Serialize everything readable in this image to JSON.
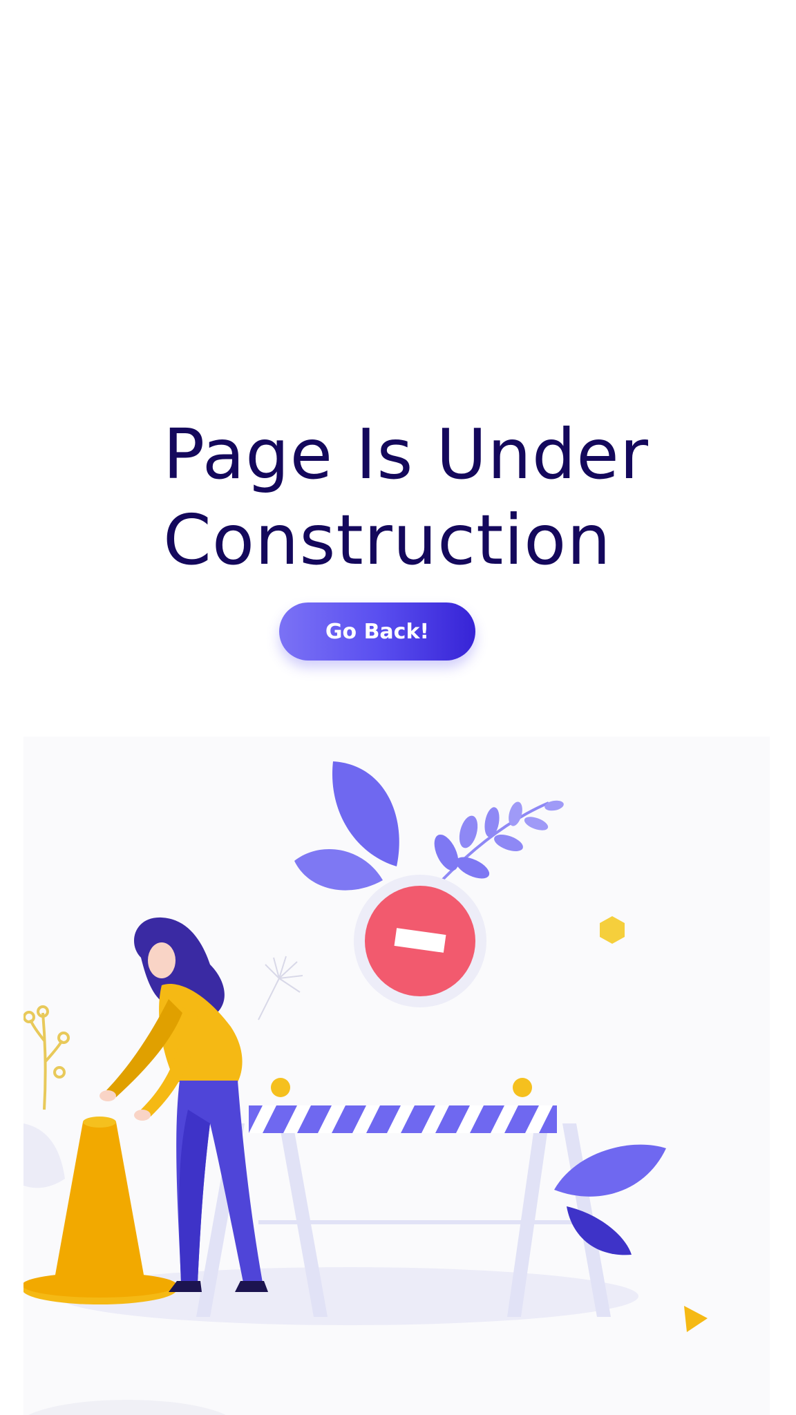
{
  "heading": {
    "line1": "Page Is Under",
    "line2": "Construction"
  },
  "back_button": {
    "label": "Go Back!"
  },
  "icons": {
    "no_entry_sign": "no-entry-icon",
    "leaves": "leaf-icon",
    "traffic_cone": "traffic-cone-icon",
    "barrier": "barrier-icon"
  },
  "colors": {
    "title": "#14085c",
    "accent_purple": "#5a4ff0",
    "warning_red": "#f25a6e",
    "cone_orange": "#f2a900",
    "shirt_yellow": "#f5b914"
  }
}
